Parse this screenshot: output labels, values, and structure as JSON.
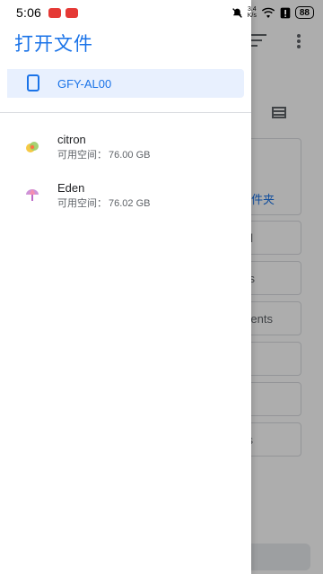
{
  "status_bar": {
    "time": "5:06",
    "speed_value": "3.4",
    "speed_unit": "K/s",
    "battery": "88"
  },
  "drawer": {
    "title": "打开文件",
    "device": {
      "label": "GFY-AL00"
    },
    "apps": [
      {
        "name": "citron",
        "space_label": "可用空间：",
        "space_value": "76.00 GB",
        "icon": "citron-app-icon"
      },
      {
        "name": "Eden",
        "space_label": "可用空间：",
        "space_value": "76.02 GB",
        "icon": "eden-app-icon"
      }
    ]
  },
  "background": {
    "folder_text": "件夹",
    "card_texts": [
      "l",
      "s",
      "ents",
      "s"
    ]
  },
  "colors": {
    "accent": "#1a73e8",
    "selected_bg": "#e8f0fe"
  }
}
